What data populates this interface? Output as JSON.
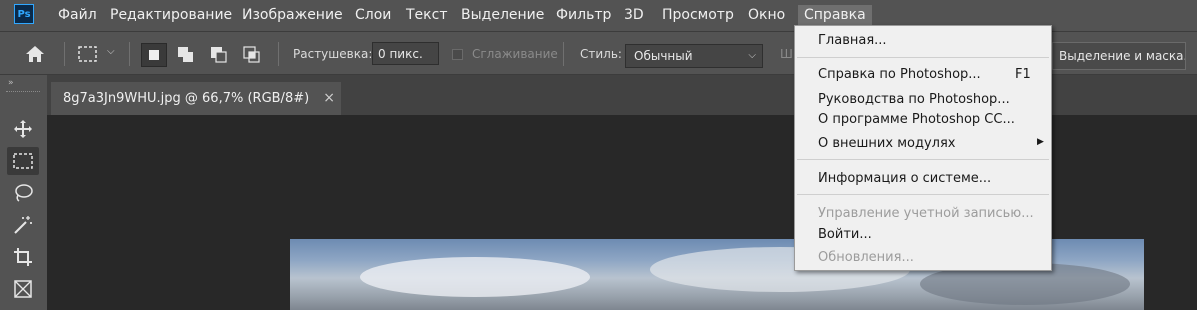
{
  "app": {
    "logo": "Ps"
  },
  "menubar": {
    "items": [
      "Файл",
      "Редактирование",
      "Изображение",
      "Слои",
      "Текст",
      "Выделение",
      "Фильтр",
      "3D",
      "Просмотр",
      "Окно",
      "Справка"
    ],
    "active": "Справка"
  },
  "options": {
    "feather_label": "Растушевка:",
    "feather_value": "0 пикс.",
    "antialias_label": "Сглаживание",
    "style_label": "Стиль:",
    "style_value": "Обычный",
    "width_label_partial": "Ш",
    "select_mask_button": "Выделение и маска..."
  },
  "document": {
    "tab_title": "8g7a3Jn9WHU.jpg @ 66,7% (RGB/8#)",
    "close": "×"
  },
  "help_menu": {
    "home": "Главная...",
    "help": "Справка по Photoshop...",
    "help_shortcut": "F1",
    "tutorials": "Руководства по Photoshop...",
    "about": "О программе Photoshop CC...",
    "plugins": "О внешних модулях",
    "system_info": "Информация о системе...",
    "account": "Управление учетной записью...",
    "sign_in": "Войти...",
    "updates": "Обновления..."
  },
  "tools": [
    "move-tool",
    "marquee-tool",
    "lasso-tool",
    "magic-wand-tool",
    "crop-tool",
    "frame-tool"
  ],
  "colors": {
    "ui_panel": "#535353",
    "canvas": "#282828",
    "menu_bg": "#f0f0f0",
    "accent": "#31a8ff"
  }
}
